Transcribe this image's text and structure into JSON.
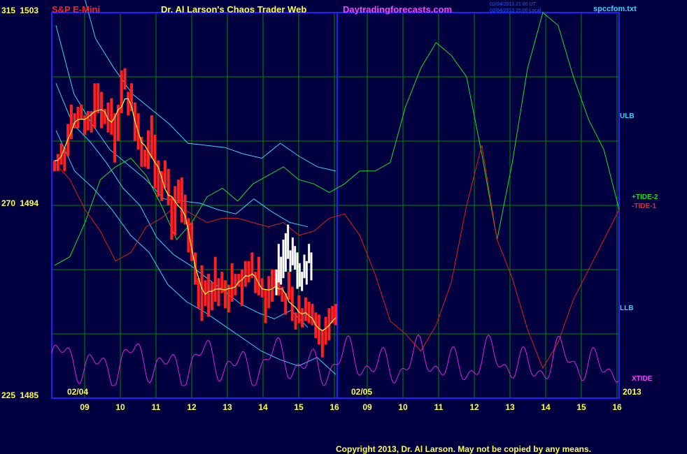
{
  "header": {
    "instrument": "S&P E-Mini",
    "source": "Dr. Al Larson's Chaos Trader Web",
    "site": "Daytradingforecasts.com",
    "timestamp_1": "02/04/2013 21:00 UT",
    "timestamp_2": "02/04/2013 15:00 Local",
    "file": "spccfom.txt"
  },
  "y_axis": {
    "top": {
      "left": "315",
      "right": "1503"
    },
    "mid": {
      "left": "270",
      "right": "1494"
    },
    "bottom": {
      "left": "225",
      "right": "1485"
    }
  },
  "date_labels": {
    "start": "02/04",
    "mid": "02/05",
    "year": "2013"
  },
  "series_labels": {
    "ulb": "ULB",
    "tide2": "+TIDE-2",
    "tide1": "-TIDE-1",
    "llb": "LLB",
    "xtide": "XTIDE"
  },
  "footer": {
    "copyright": "Copyright 2013, Dr. Al Larson. May not be copied by any means."
  },
  "colors": {
    "background": "#000040",
    "frame": "#2020ff",
    "grid": "#008800",
    "price_up": "#ff2020",
    "price_forecast": "#ffffff",
    "avg": "#ffff40",
    "band": "#40d0ff",
    "tide2": "#20e020",
    "tide1": "#e02010",
    "xtide": "#e020e0",
    "label_red": "#ff2020",
    "label_yellow": "#ffff40",
    "label_magenta": "#ff40ff",
    "label_cyan": "#40d0ff"
  },
  "chart_data": {
    "type": "line",
    "title": "S&P E-Mini",
    "x_hour_ticks": [
      "09",
      "10",
      "11",
      "12",
      "13",
      "14",
      "15",
      "16",
      "09",
      "10",
      "11",
      "12",
      "13",
      "14",
      "15",
      "16"
    ],
    "y_range_price": [
      1485,
      1503
    ],
    "y_range_osc": [
      225,
      315
    ],
    "price_bars": [
      {
        "h": 1496.1,
        "l": 1495.6
      },
      {
        "h": 1496.4,
        "l": 1495.6
      },
      {
        "h": 1496.9,
        "l": 1495.9
      },
      {
        "h": 1496.7,
        "l": 1495.6
      },
      {
        "h": 1497.8,
        "l": 1496.3
      },
      {
        "h": 1498.7,
        "l": 1497.1
      },
      {
        "h": 1498.3,
        "l": 1497.6
      },
      {
        "h": 1498.6,
        "l": 1497.6
      },
      {
        "h": 1498.7,
        "l": 1498.0
      },
      {
        "h": 1498.2,
        "l": 1497.3
      },
      {
        "h": 1498.4,
        "l": 1497.5
      },
      {
        "h": 1498.4,
        "l": 1497.4
      },
      {
        "h": 1499.7,
        "l": 1497.6
      },
      {
        "h": 1499.7,
        "l": 1498.3
      },
      {
        "h": 1499.3,
        "l": 1497.6
      },
      {
        "h": 1498.5,
        "l": 1497.8
      },
      {
        "h": 1498.8,
        "l": 1497.4
      },
      {
        "h": 1499.0,
        "l": 1497.3
      },
      {
        "h": 1498.3,
        "l": 1496.0
      },
      {
        "h": 1498.7,
        "l": 1497.0
      },
      {
        "h": 1500.3,
        "l": 1498.3
      },
      {
        "h": 1500.4,
        "l": 1499.4
      },
      {
        "h": 1499.3,
        "l": 1498.2
      },
      {
        "h": 1499.7,
        "l": 1498.4
      },
      {
        "h": 1498.8,
        "l": 1497.0
      },
      {
        "h": 1498.3,
        "l": 1496.6
      },
      {
        "h": 1497.2,
        "l": 1495.8
      },
      {
        "h": 1496.6,
        "l": 1495.8
      },
      {
        "h": 1497.5,
        "l": 1495.7
      },
      {
        "h": 1498.2,
        "l": 1496.2
      },
      {
        "h": 1497.3,
        "l": 1494.8
      },
      {
        "h": 1496.1,
        "l": 1494.4
      },
      {
        "h": 1495.6,
        "l": 1494.2
      },
      {
        "h": 1496.1,
        "l": 1494.8
      },
      {
        "h": 1495.7,
        "l": 1494.0
      },
      {
        "h": 1494.4,
        "l": 1492.4
      },
      {
        "h": 1494.9,
        "l": 1492.6
      },
      {
        "h": 1495.2,
        "l": 1494.1
      },
      {
        "h": 1495.3,
        "l": 1493.2
      },
      {
        "h": 1494.5,
        "l": 1493.1
      },
      {
        "h": 1493.4,
        "l": 1491.8
      },
      {
        "h": 1493.2,
        "l": 1491.4
      },
      {
        "h": 1491.8,
        "l": 1490.3
      },
      {
        "h": 1490.6,
        "l": 1489.2
      },
      {
        "h": 1491.2,
        "l": 1488.6
      },
      {
        "h": 1490.5,
        "l": 1489.3
      },
      {
        "h": 1490.8,
        "l": 1488.8
      },
      {
        "h": 1490.4,
        "l": 1489.1
      },
      {
        "h": 1491.6,
        "l": 1489.5
      },
      {
        "h": 1490.6,
        "l": 1489.3
      },
      {
        "h": 1490.9,
        "l": 1489.9
      },
      {
        "h": 1490.5,
        "l": 1489.2
      },
      {
        "h": 1490.3,
        "l": 1489.0
      },
      {
        "h": 1491.3,
        "l": 1489.5
      },
      {
        "h": 1490.8,
        "l": 1489.8
      },
      {
        "h": 1490.8,
        "l": 1490.2
      },
      {
        "h": 1491.0,
        "l": 1489.3
      },
      {
        "h": 1491.4,
        "l": 1490.2
      },
      {
        "h": 1491.4,
        "l": 1490.4
      },
      {
        "h": 1491.8,
        "l": 1490.6
      },
      {
        "h": 1490.9,
        "l": 1489.9
      },
      {
        "h": 1491.6,
        "l": 1489.8
      },
      {
        "h": 1490.6,
        "l": 1489.7
      },
      {
        "h": 1490.1,
        "l": 1488.5
      },
      {
        "h": 1490.7,
        "l": 1489.2
      },
      {
        "h": 1491.0,
        "l": 1489.5
      },
      {
        "h": 1491.0,
        "l": 1490.2
      },
      {
        "h": 1491.0,
        "l": 1489.8
      },
      {
        "h": 1490.2,
        "l": 1489.5
      },
      {
        "h": 1489.9,
        "l": 1488.9
      },
      {
        "h": 1490.9,
        "l": 1489.6
      },
      {
        "h": 1490.2,
        "l": 1488.6
      },
      {
        "h": 1489.0,
        "l": 1488.2
      },
      {
        "h": 1489.8,
        "l": 1488.5
      },
      {
        "h": 1489.2,
        "l": 1488.3
      },
      {
        "h": 1489.7,
        "l": 1488.6
      },
      {
        "h": 1489.5,
        "l": 1488.5
      },
      {
        "h": 1489.4,
        "l": 1488.4
      },
      {
        "h": 1489.0,
        "l": 1487.8
      },
      {
        "h": 1488.9,
        "l": 1487.5
      },
      {
        "h": 1488.2,
        "l": 1486.9
      },
      {
        "h": 1488.8,
        "l": 1487.5
      },
      {
        "h": 1489.2,
        "l": 1487.7
      },
      {
        "h": 1489.3,
        "l": 1488.5
      },
      {
        "h": 1489.4,
        "l": 1488.4
      }
    ],
    "forecast_bars": [
      {
        "h": 1491.0,
        "l": 1489.8
      },
      {
        "h": 1492.2,
        "l": 1490.4
      },
      {
        "h": 1491.6,
        "l": 1490.3
      },
      {
        "h": 1492.4,
        "l": 1490.6
      },
      {
        "h": 1492.7,
        "l": 1490.9
      },
      {
        "h": 1493.1,
        "l": 1491.5
      },
      {
        "h": 1491.9,
        "l": 1490.9
      },
      {
        "h": 1492.5,
        "l": 1491.2
      },
      {
        "h": 1492.1,
        "l": 1491.0
      },
      {
        "h": 1491.8,
        "l": 1490.1
      },
      {
        "h": 1491.3,
        "l": 1490.2
      },
      {
        "h": 1490.9,
        "l": 1490.0
      },
      {
        "h": 1491.7,
        "l": 1490.6
      },
      {
        "h": 1491.4,
        "l": 1490.3
      },
      {
        "h": 1492.2,
        "l": 1491.3
      },
      {
        "h": 1491.8,
        "l": 1490.5
      }
    ],
    "ulb_points": [
      [
        0,
        1505
      ],
      [
        1,
        1501.8
      ],
      [
        2,
        1500.4
      ],
      [
        3,
        1499.2
      ],
      [
        4,
        1498.5
      ],
      [
        5,
        1497.8
      ],
      [
        6,
        1496.9
      ],
      [
        7,
        1496.8
      ],
      [
        8,
        1496.7
      ],
      [
        9,
        1496.4
      ],
      [
        10,
        1496.2
      ],
      [
        11,
        1496.9
      ],
      [
        12,
        1496.3
      ],
      [
        13,
        1495.8
      ],
      [
        14,
        1495.6
      ]
    ],
    "llb_points": [
      [
        0,
        1497.5
      ],
      [
        1,
        1495.6
      ],
      [
        2,
        1494.8
      ],
      [
        3,
        1493.8
      ],
      [
        4,
        1492.6
      ],
      [
        5,
        1491.8
      ],
      [
        6,
        1490.3
      ],
      [
        7,
        1489.5
      ],
      [
        8,
        1489.0
      ],
      [
        9,
        1488.4
      ],
      [
        10,
        1487.8
      ],
      [
        11,
        1487.2
      ],
      [
        12,
        1486.8
      ],
      [
        13,
        1486.5
      ],
      [
        14,
        1486.9
      ],
      [
        15,
        1486.1
      ]
    ],
    "tide2_points": [
      [
        0,
        256
      ],
      [
        1,
        258
      ],
      [
        2,
        266
      ],
      [
        3,
        276
      ],
      [
        4,
        279
      ],
      [
        5,
        281
      ],
      [
        6,
        277
      ],
      [
        7,
        270
      ],
      [
        8,
        262
      ],
      [
        9,
        266
      ],
      [
        10,
        272
      ],
      [
        11,
        274
      ],
      [
        12,
        271
      ],
      [
        13,
        275
      ],
      [
        14,
        277
      ],
      [
        15,
        279
      ],
      [
        16,
        276
      ],
      [
        17,
        275
      ],
      [
        18,
        273
      ],
      [
        19,
        275
      ],
      [
        20,
        278
      ],
      [
        21,
        278
      ],
      [
        22,
        280
      ],
      [
        23,
        293
      ],
      [
        24,
        302
      ],
      [
        25,
        308
      ],
      [
        26,
        305
      ],
      [
        27,
        300
      ],
      [
        28,
        282
      ],
      [
        29,
        262
      ],
      [
        30,
        280
      ],
      [
        31,
        302
      ],
      [
        32,
        315
      ],
      [
        33,
        312
      ],
      [
        34,
        300
      ],
      [
        35,
        290
      ],
      [
        36,
        283
      ],
      [
        37,
        269
      ]
    ],
    "tide1_points": [
      [
        0,
        280
      ],
      [
        1,
        276
      ],
      [
        2,
        269
      ],
      [
        3,
        264
      ],
      [
        4,
        257
      ],
      [
        5,
        259
      ],
      [
        6,
        265
      ],
      [
        7,
        267
      ],
      [
        8,
        270
      ],
      [
        9,
        268
      ],
      [
        10,
        266
      ],
      [
        11,
        267
      ],
      [
        12,
        267
      ],
      [
        13,
        266
      ],
      [
        14,
        265
      ],
      [
        15,
        266
      ],
      [
        16,
        263
      ],
      [
        17,
        264
      ],
      [
        18,
        267
      ],
      [
        19,
        268
      ],
      [
        20,
        263
      ],
      [
        21,
        254
      ],
      [
        22,
        243
      ],
      [
        23,
        240
      ],
      [
        24,
        236
      ],
      [
        25,
        242
      ],
      [
        26,
        252
      ],
      [
        27,
        270
      ],
      [
        28,
        284
      ],
      [
        29,
        262
      ],
      [
        30,
        253
      ],
      [
        31,
        241
      ],
      [
        32,
        232
      ],
      [
        33,
        238
      ],
      [
        34,
        248
      ],
      [
        35,
        255
      ],
      [
        36,
        262
      ],
      [
        37,
        269
      ]
    ]
  }
}
